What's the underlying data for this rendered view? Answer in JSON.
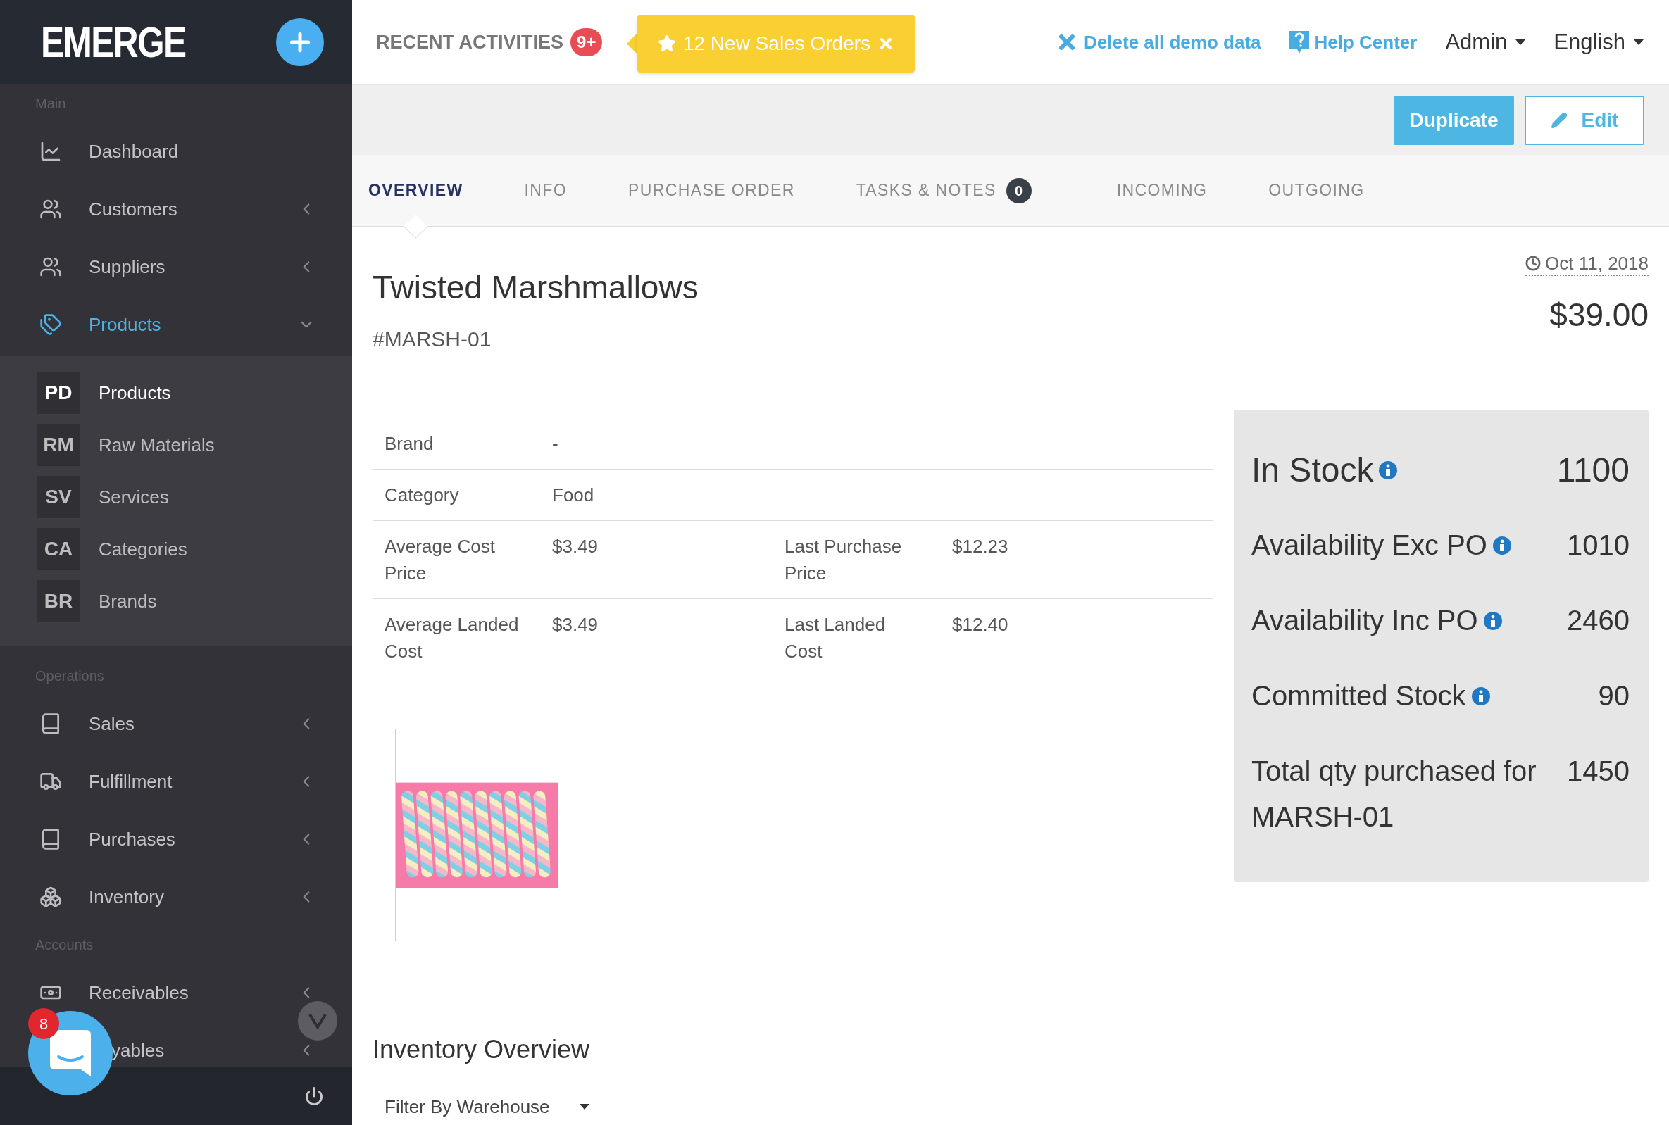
{
  "sidebar": {
    "logo": "EMERGE",
    "sections": [
      {
        "title": "Main",
        "items": [
          {
            "label": "Dashboard",
            "kind": "link",
            "selected": false
          },
          {
            "label": "Customers",
            "kind": "menu",
            "selected": false,
            "expanded": false
          },
          {
            "label": "Suppliers",
            "kind": "menu",
            "selected": false,
            "expanded": false
          },
          {
            "label": "Products",
            "kind": "menu",
            "selected": true,
            "expanded": true,
            "children": [
              {
                "code": "PD",
                "label": "Products",
                "selected": true
              },
              {
                "code": "RM",
                "label": "Raw Materials",
                "selected": false
              },
              {
                "code": "SV",
                "label": "Services",
                "selected": false
              },
              {
                "code": "CA",
                "label": "Categories",
                "selected": false
              },
              {
                "code": "BR",
                "label": "Brands",
                "selected": false
              }
            ]
          }
        ]
      },
      {
        "title": "Operations",
        "items": [
          {
            "label": "Sales",
            "kind": "menu",
            "selected": false,
            "expanded": false
          },
          {
            "label": "Fulfillment",
            "kind": "menu",
            "selected": false,
            "expanded": false
          },
          {
            "label": "Purchases",
            "kind": "menu",
            "selected": false,
            "expanded": false
          },
          {
            "label": "Inventory",
            "kind": "menu",
            "selected": false,
            "expanded": false
          }
        ]
      },
      {
        "title": "Accounts",
        "items": [
          {
            "label": "Receivables",
            "kind": "menu",
            "selected": false,
            "expanded": false
          },
          {
            "label": "yables",
            "kind": "menu",
            "selected": false,
            "expanded": false
          }
        ]
      }
    ]
  },
  "chat": {
    "badge": "8"
  },
  "top_bar": {
    "recent_activities": "RECENT ACTIVITIES",
    "activity_badge": "9+",
    "notification": "12 New Sales Orders",
    "links": [
      "Delete all demo data",
      "Help Center"
    ],
    "menus": [
      "Admin",
      "English"
    ]
  },
  "actions": [
    {
      "label": "Duplicate",
      "kind": "primary"
    },
    {
      "label": "Edit",
      "kind": "outline"
    }
  ],
  "tabs": [
    {
      "label": "OVERVIEW",
      "selected": true
    },
    {
      "label": "INFO",
      "selected": false
    },
    {
      "label": "PURCHASE ORDER",
      "selected": false
    },
    {
      "label": "TASKS & NOTES",
      "selected": false,
      "badge": "0"
    },
    {
      "label": "INCOMING",
      "selected": false
    },
    {
      "label": "OUTGOING",
      "selected": false
    }
  ],
  "product": {
    "name": "Twisted Marshmallows",
    "sku": "#MARSH-01",
    "date": "Oct 11, 2018",
    "price": "$39.00"
  },
  "details": [
    [
      {
        "label": "Brand",
        "value": "-"
      }
    ],
    [
      {
        "label": "Category",
        "value": "Food"
      }
    ],
    [
      {
        "label": "Average Cost Price",
        "value": "$3.49"
      },
      {
        "label": "Last Purchase Price",
        "value": "$12.23"
      }
    ],
    [
      {
        "label": "Average Landed Cost",
        "value": "$3.49"
      },
      {
        "label": "Last Landed Cost",
        "value": "$12.40"
      }
    ]
  ],
  "stock": [
    {
      "label": "In Stock",
      "value": "1100",
      "info": true
    },
    {
      "label": "Availability Exc PO",
      "value": "1010",
      "info": true
    },
    {
      "label": "Availability Inc PO",
      "value": "2460",
      "info": true
    },
    {
      "label": "Committed Stock",
      "value": "90",
      "info": true
    },
    {
      "label": "Total qty purchased for MARSH-01",
      "value": "1450",
      "info": false
    }
  ],
  "inventory_overview": {
    "title": "Inventory Overview",
    "filter": "Filter By Warehouse"
  }
}
